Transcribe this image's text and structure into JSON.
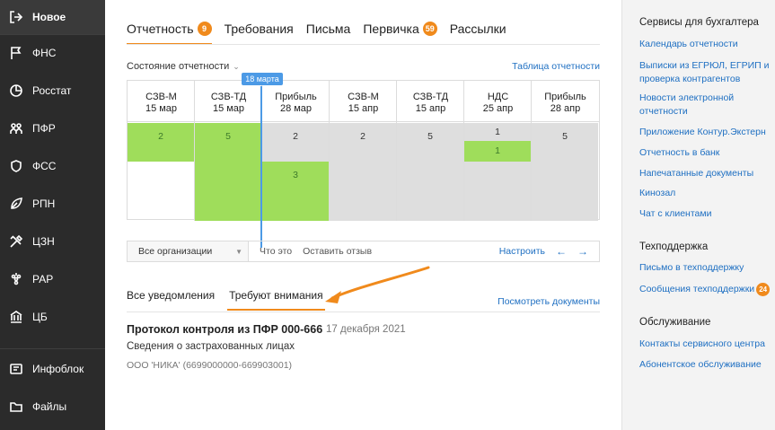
{
  "sidebar": {
    "items": [
      {
        "label": "Новое",
        "icon": "logout-icon"
      },
      {
        "label": "ФНС",
        "icon": "flag-icon"
      },
      {
        "label": "Росстат",
        "icon": "pie-chart-icon"
      },
      {
        "label": "ПФР",
        "icon": "people-icon"
      },
      {
        "label": "ФСС",
        "icon": "shield-icon"
      },
      {
        "label": "РПН",
        "icon": "leaf-icon"
      },
      {
        "label": "ЦЗН",
        "icon": "tools-icon"
      },
      {
        "label": "РАР",
        "icon": "grapes-icon"
      },
      {
        "label": "ЦБ",
        "icon": "bank-icon"
      },
      {
        "label": "Инфоблок",
        "icon": "info-icon"
      },
      {
        "label": "Файлы",
        "icon": "folder-icon"
      }
    ]
  },
  "main": {
    "tabs": [
      {
        "label": "Отчетность",
        "badge": "9"
      },
      {
        "label": "Требования",
        "badge": ""
      },
      {
        "label": "Письма",
        "badge": ""
      },
      {
        "label": "Первичка",
        "badge": "59"
      },
      {
        "label": "Рассылки",
        "badge": ""
      }
    ],
    "state_label": "Состояние отчетности",
    "state_link": "Таблица отчетности",
    "timeline_label": "18 марта",
    "columns": [
      {
        "name": "СЗВ-М",
        "date": "15 мар",
        "cells": [
          "2"
        ]
      },
      {
        "name": "СЗВ-ТД",
        "date": "15 мар",
        "cells": [
          "5"
        ]
      },
      {
        "name": "Прибыль",
        "date": "28 мар",
        "cells": [
          "2",
          "3"
        ]
      },
      {
        "name": "СЗВ-М",
        "date": "15 апр",
        "cells": [
          "2"
        ]
      },
      {
        "name": "СЗВ-ТД",
        "date": "15 апр",
        "cells": [
          "5"
        ]
      },
      {
        "name": "НДС",
        "date": "25 апр",
        "cells": [
          "1",
          "1"
        ]
      },
      {
        "name": "Прибыль",
        "date": "28 апр",
        "cells": [
          "5"
        ]
      }
    ],
    "toolbar": {
      "org_select": "Все организации",
      "what_is": "Что это",
      "feedback": "Оставить отзыв",
      "configure": "Настроить"
    },
    "subtabs": [
      "Все уведомления",
      "Требуют внимания"
    ],
    "view_docs": "Посмотреть документы",
    "notification": {
      "title": "Протокол контроля из ПФР 000-666",
      "date": "17 декабря 2021",
      "subtitle": "Сведения о застрахованных лицах",
      "org": "ООО 'НИКА' (6699000000-669903001)"
    }
  },
  "right_panel": {
    "sections": [
      {
        "title": "Сервисы для бухгалтера",
        "links": [
          "Календарь отчетности",
          "Выписки из ЕГРЮЛ, ЕГРИП и проверка контрагентов",
          "Новости электронной отчетности",
          "Приложение Контур.Экстерн",
          "Отчетность в банк",
          "Напечатанные документы",
          "Кинозал",
          "Чат с клиентами"
        ]
      },
      {
        "title": "Техподдержка",
        "links": [
          "Письмо в техподдержку",
          "Сообщения техподдержки"
        ],
        "badge": "24"
      },
      {
        "title": "Обслуживание",
        "links": [
          "Контакты сервисного центра",
          "Абонентское обслуживание"
        ]
      }
    ]
  },
  "colors": {
    "accent": "#f08a1c",
    "link": "#1e6fc2",
    "green": "#9fdd5b",
    "grey": "#dedede",
    "timeline": "#4c9ae6",
    "sidebar": "#2b2b2b"
  }
}
